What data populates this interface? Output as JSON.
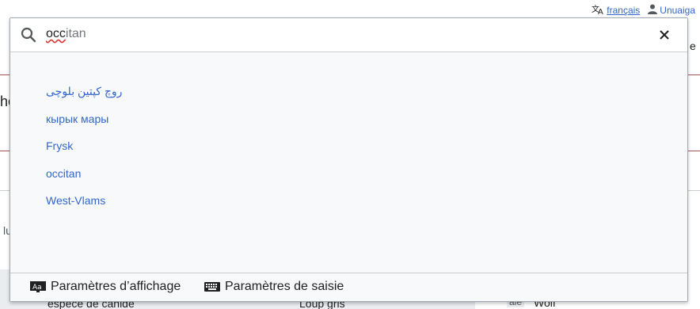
{
  "personal_bar": {
    "language_label": "français",
    "user_label": "Unuaiga"
  },
  "background": {
    "left_fragment_1": "he",
    "left_fragment_2": "lu",
    "tab_fragment": "e",
    "table_cell_1": "espèce de canidé",
    "table_cell_2": "Loup gris",
    "table_cell_3": "Wolf",
    "lang_badge": "ale"
  },
  "search": {
    "typed": "occ",
    "completion": "itan",
    "suggestions": [
      "روچ کپتین بلوچی",
      "кырык мары",
      "Frysk",
      "occitan",
      "West-Vlams"
    ],
    "footer": {
      "display_settings": "Paramètres d’affichage",
      "input_settings": "Paramètres de saisie"
    }
  },
  "colors": {
    "link": "#3366cc",
    "border": "#a2a9b1",
    "panel": "#f8f9fa",
    "accent_line": "#8b1a1a"
  }
}
